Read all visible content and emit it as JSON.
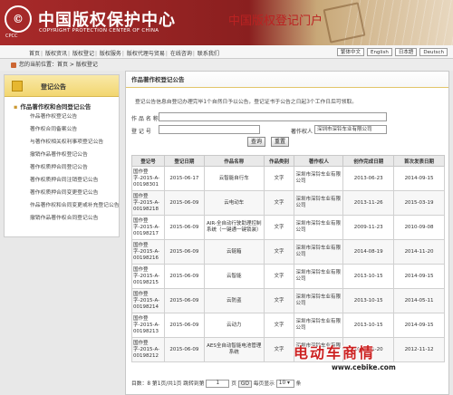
{
  "header": {
    "logo_text": "©",
    "logo_sub": "CPCC",
    "org_name": "中国版权保护中心",
    "org_en": "COPYRIGHT PROTECTION CENTER OF CHINA",
    "portal_title": "中国版权登记门户"
  },
  "topnav": {
    "links": [
      "首页",
      "版权资讯",
      "版权登记",
      "版权服务",
      "版权代理与贸易",
      "在线咨询",
      "联系我们"
    ],
    "languages": [
      "繁体中文",
      "English",
      "日本語",
      "Deutsch"
    ]
  },
  "breadcrumb": "您的当前位置：首页 > 版权登记",
  "sidebar": {
    "title": "登记公告",
    "group": "作品著作权和合同登记公告",
    "items": [
      "作品著作权登记公告",
      "著作权合同备案公告",
      "与著作权相关权利事项登记公告",
      "撤销作品著作权登记公告",
      "著作权质押合同登记公告",
      "著作权质押合同注销登记公告",
      "著作权质押合同变更登记公告",
      "作品著作权和合同变更或补充登记公告",
      "撤销作品著作权合同登记公告"
    ]
  },
  "main": {
    "title": "作品著作权登记公告",
    "notice": "登记公告信息自登记办理完毕1个自然日予以公告，登记证书于公告之日起3个工作日后可领取。",
    "form": {
      "name_label": "作 品 名 称",
      "reg_label": "登  记  号",
      "owner_label": "著作权人",
      "owner_value": "深圳市深铃车业有限公司",
      "query_btn": "查询",
      "reset_btn": "重置"
    },
    "table": {
      "headers": [
        "登记号",
        "登记日期",
        "作品名称",
        "作品类别",
        "著作权人",
        "创作完成日期",
        "首次发表日期"
      ],
      "rows": [
        [
          "国作登字-2015-A-00198301",
          "2015-06-17",
          "云智能自行车",
          "文字",
          "深圳市深铃车业有限公司",
          "2013-06-23",
          "2014-09-15"
        ],
        [
          "国作登字-2015-A-00198218",
          "2015-06-09",
          "云电动车",
          "文字",
          "深圳市深铃车业有限公司",
          "2013-11-26",
          "2015-03-19"
        ],
        [
          "国作登字-2015-A-00198217",
          "2015-06-09",
          "AIR-全自动行驶助理控制系统（一键通一键锁装）",
          "文字",
          "深圳市深铃车业有限公司",
          "2009-11-23",
          "2010-09-08"
        ],
        [
          "国作登字-2015-A-00198216",
          "2015-06-09",
          "云链箱",
          "文字",
          "深圳市深铃车业有限公司",
          "2014-08-19",
          "2014-11-20"
        ],
        [
          "国作登字-2015-A-00198215",
          "2015-06-09",
          "云智能",
          "文字",
          "深圳市深铃车业有限公司",
          "2013-10-15",
          "2014-09-15"
        ],
        [
          "国作登字-2015-A-00198214",
          "2015-06-09",
          "云防盗",
          "文字",
          "深圳市深铃车业有限公司",
          "2013-10-15",
          "2014-05-11"
        ],
        [
          "国作登字-2015-A-00198213",
          "2015-06-09",
          "云动力",
          "文字",
          "深圳市深铃车业有限公司",
          "2013-10-15",
          "2014-09-15"
        ],
        [
          "国作登字-2015-A-00198212",
          "2015-06-09",
          "AES全自动智能电池管理系统",
          "文字",
          "深圳市深铃车业有限公司",
          "2011-01-20",
          "2012-11-12"
        ]
      ]
    },
    "pager": {
      "summary": "目数：8 第1页/共1页",
      "jump_label": "跳转到第",
      "page_value": "1",
      "page_unit": "页",
      "go_btn": "GO",
      "per_page_label": "每页显示",
      "per_page_value": "10",
      "per_page_unit": "条"
    }
  },
  "watermark": {
    "title": "电动车商情",
    "url": "www.cebike.com"
  }
}
